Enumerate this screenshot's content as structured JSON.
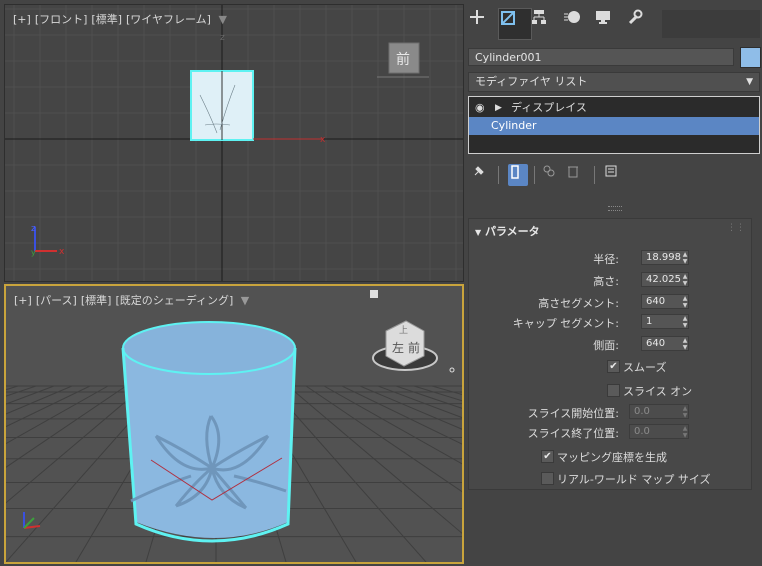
{
  "viewport_front": {
    "labels": [
      "[+]",
      "[フロント]",
      "[標準]",
      "[ワイヤフレーム]"
    ],
    "viewcube_label": "前",
    "axis_x": "x",
    "axis_z": "z",
    "filter_icon": "funnel-icon"
  },
  "viewport_persp": {
    "labels": [
      "[+]",
      "[パース]",
      "[標準]",
      "[既定のシェーディング]"
    ],
    "viewcube_front": "前",
    "viewcube_left": "左",
    "viewcube_top": "上",
    "gizmo_z": "z"
  },
  "panel": {
    "tabs": [
      "create-icon",
      "modify-icon",
      "hierarchy-icon",
      "motion-icon",
      "display-icon",
      "utilities-icon"
    ],
    "object_name": "Cylinder001",
    "object_color": "#8fbde8",
    "modifier_list": "モディファイヤ リスト",
    "stack": [
      "ディスプレイス",
      "Cylinder"
    ],
    "rollout_title": "パラメータ",
    "params": {
      "radius_label": "半径:",
      "radius_value": "18.998",
      "height_label": "高さ:",
      "height_value": "42.025",
      "height_segs_label": "高さセグメント:",
      "height_segs_value": "640",
      "cap_segs_label": "キャップ セグメント:",
      "cap_segs_value": "1",
      "sides_label": "側面:",
      "sides_value": "640",
      "smooth_label": "スムーズ",
      "smooth_checked": true,
      "slice_label": "スライス オン",
      "slice_checked": false,
      "slice_from_label": "スライス開始位置:",
      "slice_from_value": "0.0",
      "slice_to_label": "スライス終了位置:",
      "slice_to_value": "0.0",
      "mapping_label": "マッピング座標を生成",
      "mapping_checked": true,
      "realworld_label": "リアル-ワールド マップ サイズ",
      "realworld_checked": false
    }
  },
  "colors": {
    "accent": "#5b86c4",
    "selection": "#5ef2f2",
    "active_border": "#c9a43c",
    "cylinder": "#8bb8e0"
  }
}
